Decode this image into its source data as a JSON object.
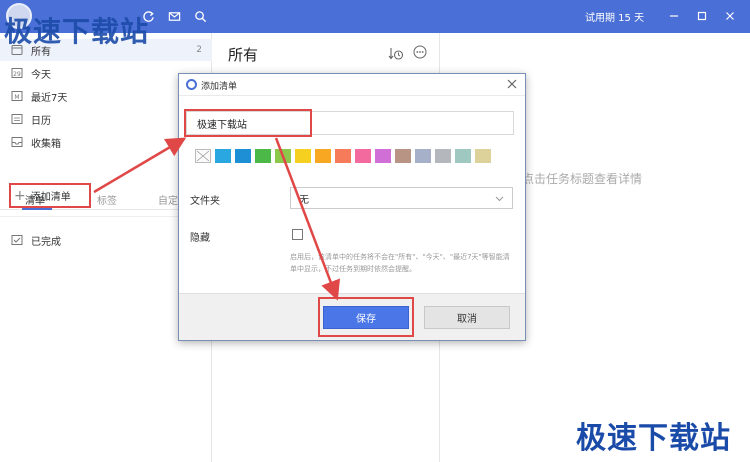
{
  "titlebar": {
    "trial_text": "试用期 15 天"
  },
  "sidebar": {
    "items": [
      {
        "label": "所有",
        "count": "2",
        "icon": "inbox-icon"
      },
      {
        "label": "今天",
        "icon": "calendar-day-icon",
        "icon_text": "29"
      },
      {
        "label": "最近7天",
        "icon": "calendar-week-icon",
        "icon_text": "M"
      },
      {
        "label": "日历",
        "icon": "calendar-icon"
      },
      {
        "label": "收集箱",
        "icon": "tray-icon"
      }
    ],
    "tabs": [
      "清单",
      "标签",
      "自定"
    ],
    "add_list_label": "添加清单",
    "completed_label": "已完成"
  },
  "middle": {
    "title": "所有"
  },
  "right": {
    "hint": "点击任务标题查看详情"
  },
  "dialog": {
    "title": "添加清单",
    "name_value": "极速下载站",
    "colors": [
      "#2aa7e0",
      "#1e8fd4",
      "#4cb848",
      "#8cc84a",
      "#f5d020",
      "#f7a722",
      "#f57b5b",
      "#f36a9e",
      "#d06fd6",
      "#b89484",
      "#a6b0c8",
      "#b4b8bc",
      "#9fc8c0",
      "#ddd29a"
    ],
    "folder_label": "文件夹",
    "folder_value": "无",
    "hide_label": "隐藏",
    "hide_desc": "启用后，该清单中的任务将不会在\"所有\"、\"今天\"、\"最近7天\"等智能清单中显示，不过任务到期时依然会提醒。",
    "save_label": "保存",
    "cancel_label": "取消"
  },
  "watermark": {
    "top": "极速下载站",
    "bottom": "极速下载站"
  },
  "colors": {
    "accent": "#4a6fd6",
    "annotation": "#e04848"
  }
}
